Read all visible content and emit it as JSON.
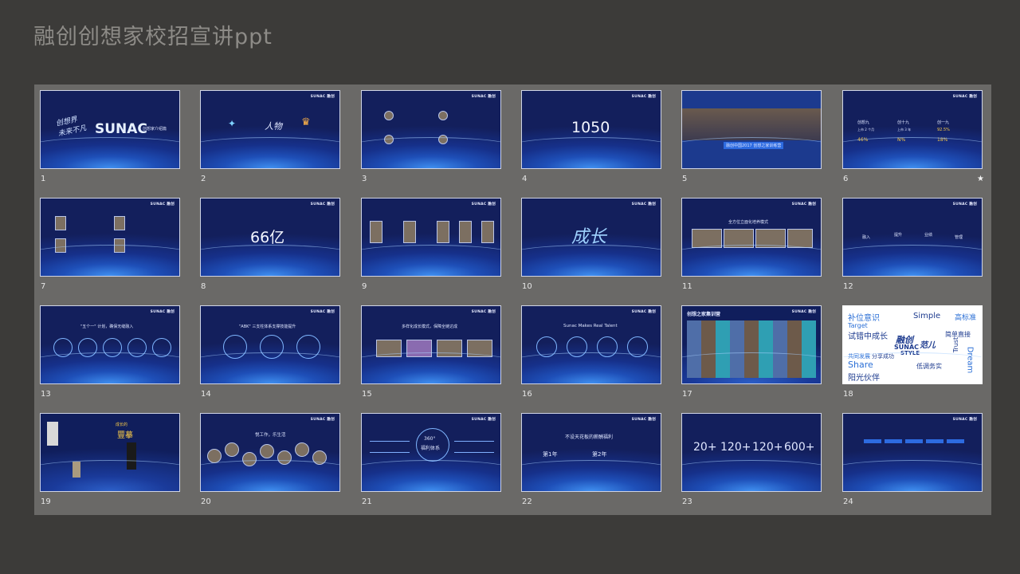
{
  "header": {
    "title": "融创创想家校招宣讲ppt"
  },
  "brand": {
    "logo": "SUNAC 融创"
  },
  "slides": [
    {
      "n": "1"
    },
    {
      "n": "2"
    },
    {
      "n": "3"
    },
    {
      "n": "4"
    },
    {
      "n": "5"
    },
    {
      "n": "6",
      "star": "★"
    },
    {
      "n": "7"
    },
    {
      "n": "8"
    },
    {
      "n": "9"
    },
    {
      "n": "10"
    },
    {
      "n": "11"
    },
    {
      "n": "12"
    },
    {
      "n": "13"
    },
    {
      "n": "14"
    },
    {
      "n": "15"
    },
    {
      "n": "16"
    },
    {
      "n": "17"
    },
    {
      "n": "18"
    },
    {
      "n": "19"
    },
    {
      "n": "20"
    },
    {
      "n": "21"
    },
    {
      "n": "22"
    },
    {
      "n": "23"
    },
    {
      "n": "24"
    }
  ],
  "s1": {
    "big": "SUNAC",
    "caption": "创想家介绍篇"
  },
  "s4": {
    "value": "1050"
  },
  "s5": {
    "banner": "融创中国2017 创想之家训练营"
  },
  "s6": {
    "h1": "创想九",
    "h2": "创十九",
    "h3": "创一九",
    "v1": "上市 2 个月",
    "v2": "上市 3 年",
    "p1": "46%",
    "p2": "N%",
    "p3": "92.5%",
    "p4": "18%"
  },
  "s8": {
    "value": "66亿"
  },
  "s10": {
    "text": "成长"
  },
  "s11": {
    "title": "全方位立面化培养模式"
  },
  "s12": {
    "steps": [
      "融入",
      "提升",
      "业绩",
      "管理"
    ]
  },
  "s13": {
    "title": "\"五个一\" 计划，确保无缝融入"
  },
  "s14": {
    "title": "\"ABK\" 三支柱体系支撑技能提升"
  },
  "s15": {
    "title": "多样化成长模式，保障全链达成"
  },
  "s16": {
    "title": "Sunac Makes Real Talent"
  },
  "s17": {
    "title": "创想之家集训营"
  },
  "s18": {
    "words": [
      "补位意识",
      "Simple",
      "高标准",
      "Target",
      "试错中成长",
      "融创",
      "SUNAC",
      "范儿",
      "STYLE",
      "简单直接",
      "共同发展",
      "分享成功",
      "Trust",
      "Share",
      "低调务实",
      "阳光伙伴",
      "Dream"
    ]
  },
  "s19": {
    "t1": "成长的",
    "t2": "豐摹"
  },
  "s20": {
    "title": "悦工作，乐生活"
  },
  "s21": {
    "center1": "360°",
    "center2": "福利体系"
  },
  "s22": {
    "title": "不设天花板的薪酬福利",
    "a": "第1年",
    "b": "第2年"
  },
  "s23": {
    "stats": [
      "20+",
      "120+",
      "120+",
      "600+"
    ]
  }
}
